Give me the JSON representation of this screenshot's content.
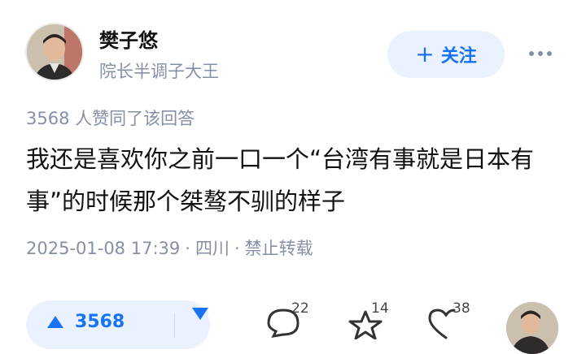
{
  "author": {
    "name": "樊子悠",
    "bio": "院长半调子大王",
    "avatar_icon": "person-avatar"
  },
  "follow_button": {
    "label": "关注",
    "icon": "plus-icon"
  },
  "more_icon": "ellipsis-icon",
  "answer": {
    "likes_note": "3568 人赞同了该回答",
    "text": "我还是喜欢你之前一口一个“台湾有事就是日本有事”的时候那个桀骜不驯的样子",
    "date": "2025-01-08 17:39",
    "location": "四川",
    "repost_policy": "禁止转载",
    "separator": "·"
  },
  "actions": {
    "upvote_count": "3568",
    "comment_count": "22",
    "favorite_count": "14",
    "like_count": "38"
  },
  "colors": {
    "accent": "#1772f6",
    "accent_bg": "#eaf2ff",
    "muted_text": "#8590a6"
  }
}
